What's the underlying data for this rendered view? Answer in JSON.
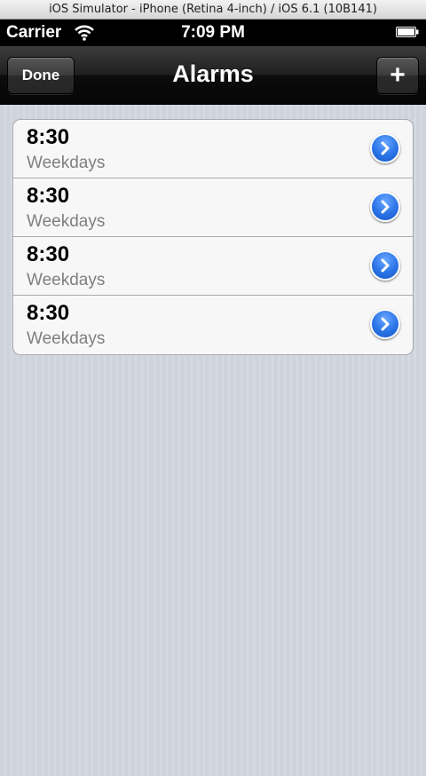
{
  "window": {
    "title": "iOS Simulator - iPhone (Retina 4-inch) / iOS 6.1 (10B141)"
  },
  "status_bar": {
    "carrier": "Carrier",
    "time": "7:09 PM"
  },
  "nav": {
    "title": "Alarms",
    "left_button": "Done",
    "right_button": "+"
  },
  "alarms": [
    {
      "time": "8:30",
      "detail": "Weekdays"
    },
    {
      "time": "8:30",
      "detail": "Weekdays"
    },
    {
      "time": "8:30",
      "detail": "Weekdays"
    },
    {
      "time": "8:30",
      "detail": "Weekdays"
    }
  ],
  "colors": {
    "accent_blue": "#2a73e6",
    "background": "#d3d7de",
    "nav_bar": "#111111"
  }
}
